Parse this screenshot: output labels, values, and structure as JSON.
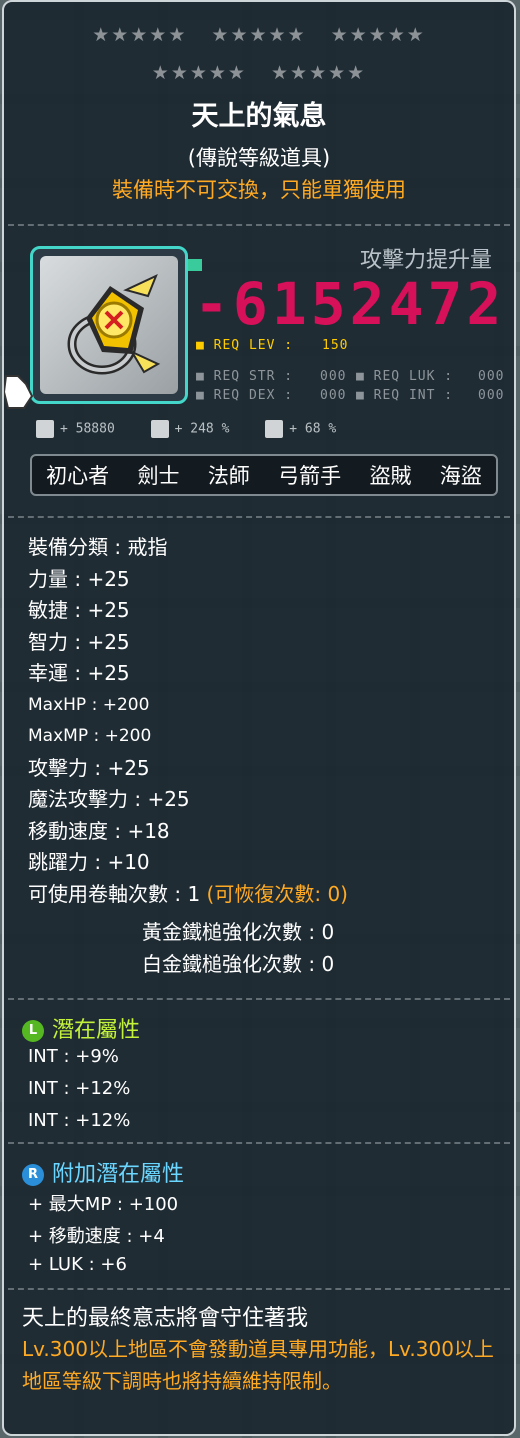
{
  "header": {
    "stars_row1": [
      "★★★★★",
      "★★★★★",
      "★★★★★"
    ],
    "stars_row2": [
      "★★★★★",
      "★★★★★"
    ],
    "title": "天上的氣息",
    "grade": "(傳說等級道具)",
    "trade_note": "裝備時不可交換，只能單獨使用"
  },
  "item": {
    "icon": "gold-ring-icon",
    "attack_label": "攻擊力提升量",
    "attack_value": "-6152472",
    "req_lev_label": "■ REQ LEV :",
    "req_lev": "150",
    "req_str_label": "■ REQ STR :",
    "req_str": "000",
    "req_luk_label": "■ REQ LUK :",
    "req_luk": "000",
    "req_dex_label": "■ REQ DEX :",
    "req_dex": "000",
    "req_int_label": "■ REQ INT :",
    "req_int": "000",
    "mini_stats": [
      "+ 58880",
      "+ 248 %",
      "+ 68 %"
    ]
  },
  "jobs": [
    "初心者",
    "劍士",
    "法師",
    "弓箭手",
    "盜賊",
    "海盜"
  ],
  "stats": [
    "裝備分類 : 戒指",
    "力量 : +25",
    "敏捷 : +25",
    "智力 : +25",
    "幸運 : +25",
    "MaxHP : +200",
    "MaxMP : +200",
    "攻擊力 : +25",
    "魔法攻擊力 : +25",
    "移動速度 : +18",
    "跳躍力 : +10"
  ],
  "scroll": {
    "label": "可使用卷軸次數 : 1",
    "recover": "(可恢復次數: 0)"
  },
  "hammer": {
    "gold": "黃金鐵槌強化次數 : 0",
    "platinum": "白金鐵槌強化次數 : 0"
  },
  "potential": {
    "badge": "L",
    "title": "潛在屬性",
    "lines": [
      "INT : +9%",
      "INT : +12%",
      "INT : +12%"
    ]
  },
  "bonus_potential": {
    "badge": "R",
    "title": "附加潛在屬性",
    "lines": [
      "+ 最大MP : +100",
      "+ 移動速度 : +4",
      "+ LUK : +6"
    ]
  },
  "description": {
    "flavor": "天上的最終意志將會守住著我",
    "note": "Lv.300以上地區不會發動道具專用功能，Lv.300以上地區等級下調時也將持續維持限制。"
  },
  "colors": {
    "attack": "#d7105a",
    "orange": "#ffaa22",
    "potential": "#c3f23a",
    "bonus": "#6bd6ff",
    "frame": "#44d6c8"
  }
}
